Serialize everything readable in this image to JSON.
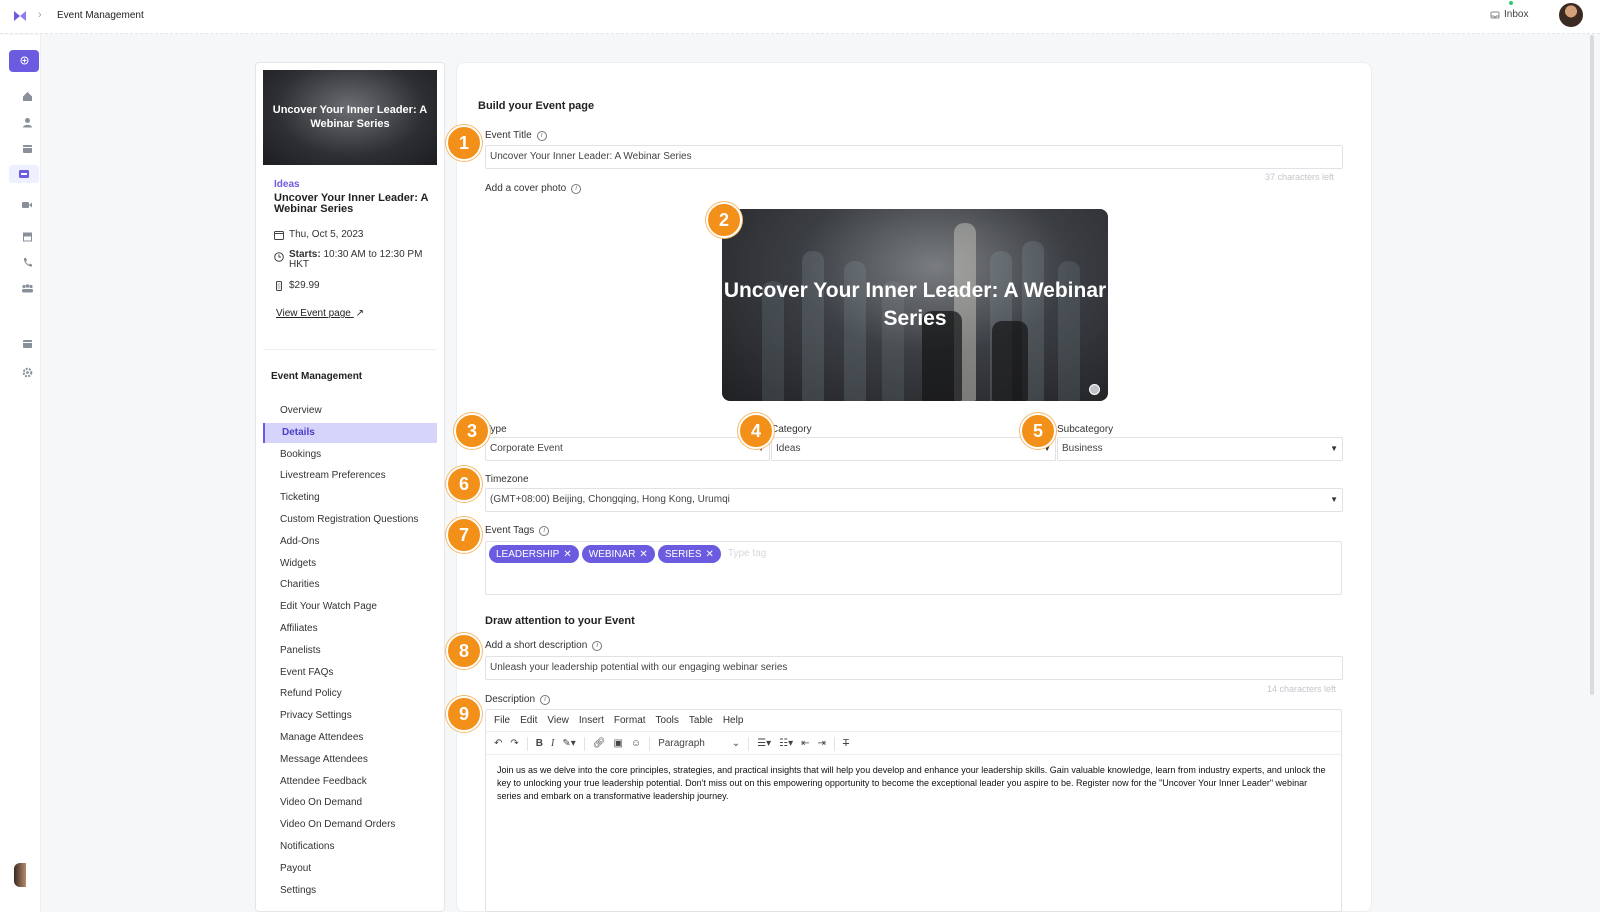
{
  "topbar": {
    "breadcrumb": "Event Management",
    "inbox_label": "Inbox"
  },
  "rail": {
    "icons": [
      "add-icon",
      "home-icon",
      "user-icon",
      "calendar-icon",
      "ticket-icon",
      "video-icon",
      "storefront-icon",
      "phone-icon",
      "group-icon",
      "card-icon",
      "gear-icon"
    ]
  },
  "event_card": {
    "thumb_title": "Uncover Your Inner Leader: A Webinar Series",
    "category": "Ideas",
    "title": "Uncover Your Inner Leader: A Webinar Series",
    "date": "Thu, Oct 5, 2023",
    "starts_label": "Starts:",
    "starts_value": " 10:30 AM to 12:30 PM HKT",
    "price": "$29.99",
    "view_link": "View Event page",
    "nav_title": "Event Management",
    "nav": [
      "Overview",
      "Details",
      "Bookings",
      "Livestream Preferences",
      "Ticketing",
      "Custom Registration Questions",
      "Add-Ons",
      "Widgets",
      "Charities",
      "Edit Your Watch Page",
      "Affiliates",
      "Panelists",
      "Event FAQs",
      "Refund Policy",
      "Privacy Settings",
      "Manage Attendees",
      "Message Attendees",
      "Attendee Feedback",
      "Video On Demand",
      "Video On Demand Orders",
      "Notifications",
      "Payout",
      "Settings"
    ],
    "active_nav": "Details"
  },
  "form": {
    "section_title": "Build your Event page",
    "event_title_label": "Event Title",
    "event_title_value": "Uncover Your Inner Leader: A Webinar Series",
    "event_title_hint": "37 characters left",
    "cover_label": "Add a cover photo",
    "cover_title": "Uncover Your Inner Leader: A Webinar Series",
    "type_label": "Type",
    "type_value": "Corporate Event",
    "category_label": "Category",
    "category_value": "Ideas",
    "subcategory_label": "Subcategory",
    "subcategory_value": "Business",
    "timezone_label": "Timezone",
    "timezone_value": "(GMT+08:00) Beijing, Chongqing, Hong Kong, Urumqi",
    "tags_label": "Event Tags",
    "tags": [
      "LEADERSHIP",
      "WEBINAR",
      "SERIES"
    ],
    "tags_placeholder": "Type tag",
    "section2_title": "Draw attention to your Event",
    "short_desc_label": "Add a short description",
    "short_desc_value": "Unleash your leadership potential with our engaging webinar series",
    "short_desc_hint": "14 characters left",
    "description_label": "Description",
    "editor_menu": [
      "File",
      "Edit",
      "View",
      "Insert",
      "Format",
      "Tools",
      "Table",
      "Help"
    ],
    "paragraph_label": "Paragraph",
    "description_text": "Join us as we delve into the core principles, strategies, and practical insights that will help you develop and enhance your leadership skills. Gain valuable knowledge, learn from industry experts, and unlock the key to unlocking your true leadership potential. Don't miss out on this empowering opportunity to become the exceptional leader you aspire to be. Register now for the \"Uncover Your Inner Leader\" webinar series and embark on a transformative leadership journey."
  },
  "badges": [
    "1",
    "2",
    "3",
    "4",
    "5",
    "6",
    "7",
    "8",
    "9"
  ],
  "colors": {
    "accent": "#6a5be0",
    "badge": "#f39019",
    "active_nav_bg": "#d6d4fa"
  }
}
